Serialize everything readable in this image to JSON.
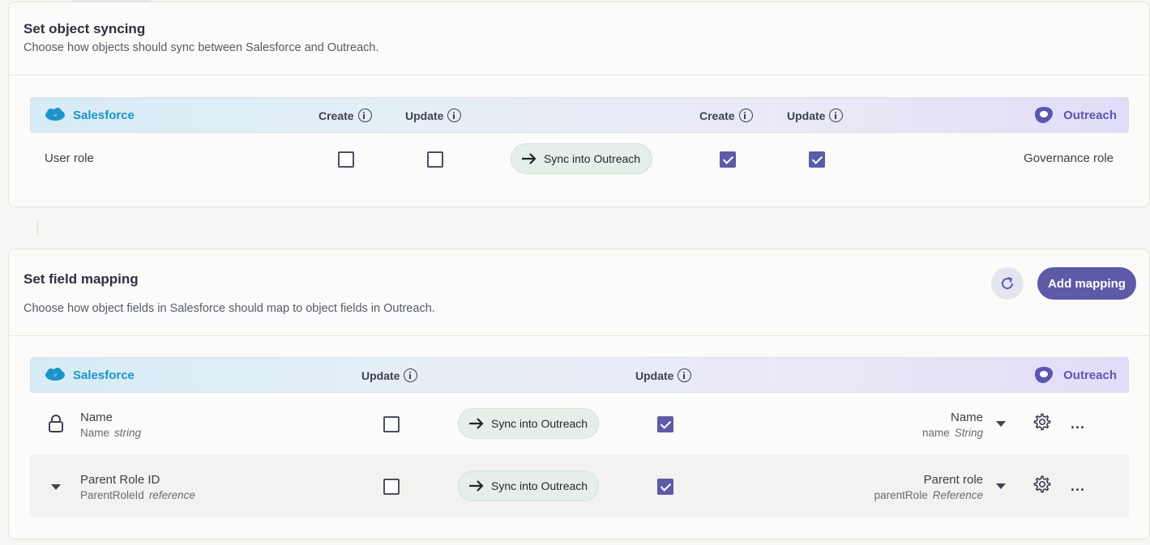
{
  "object_syncing": {
    "title": "Set object syncing",
    "subtitle": "Choose how objects should sync between Salesforce and Outreach.",
    "header": {
      "left_system": "Salesforce",
      "right_system": "Outreach",
      "sf_create": "Create",
      "sf_update": "Update",
      "or_create": "Create",
      "or_update": "Update"
    },
    "row": {
      "left": "User role",
      "sf_create_checked": false,
      "sf_update_checked": false,
      "sync_label": "Sync into Outreach",
      "or_create_checked": true,
      "or_update_checked": true,
      "right": "Governance role"
    }
  },
  "field_mapping": {
    "title": "Set field mapping",
    "subtitle": "Choose how object fields in Salesforce should map to object fields in Outreach.",
    "add_button": "Add mapping",
    "header": {
      "left_system": "Salesforce",
      "right_system": "Outreach",
      "sf_update": "Update",
      "or_update": "Update"
    },
    "rows": [
      {
        "sf_name": "Name",
        "sf_api": "Name",
        "sf_type": "string",
        "sf_update_checked": false,
        "sync_label": "Sync into Outreach",
        "or_update_checked": true,
        "or_name": "Name",
        "or_api": "name",
        "or_type": "String",
        "more": "..."
      },
      {
        "sf_name": "Parent Role ID",
        "sf_api": "ParentRoleId",
        "sf_type": "reference",
        "sf_update_checked": false,
        "sync_label": "Sync into Outreach",
        "or_update_checked": true,
        "or_name": "Parent role",
        "or_api": "parentRole",
        "or_type": "Reference",
        "more": "..."
      }
    ]
  },
  "colors": {
    "accent": "#5d5aa7",
    "salesforce": "#1d94c9",
    "sync_pill": "#e5efea"
  },
  "icons": [
    "info-icon",
    "salesforce-logo",
    "outreach-logo",
    "arrow-right-icon",
    "lock-icon",
    "chevron-down-icon",
    "gear-icon",
    "more-icon",
    "refresh-icon"
  ]
}
